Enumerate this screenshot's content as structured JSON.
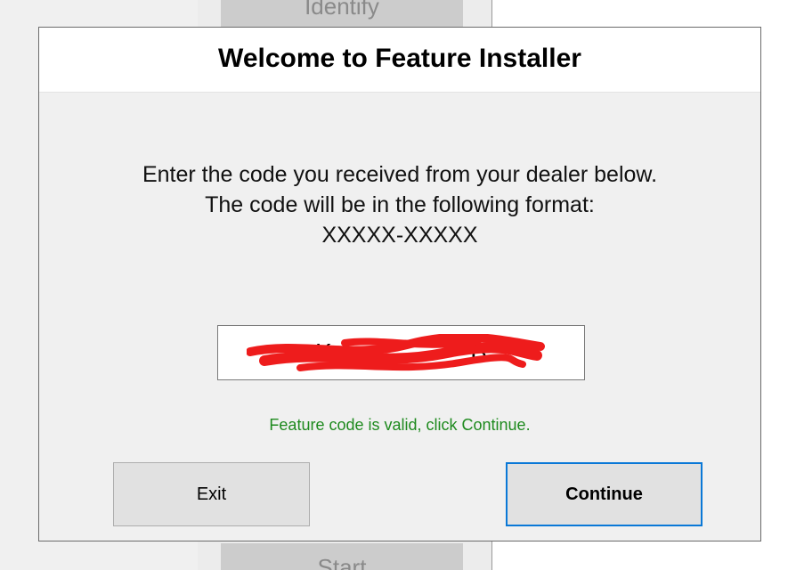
{
  "background": {
    "top_button_label": "Identify",
    "bottom_button_label": "Start"
  },
  "dialog": {
    "title": "Welcome to Feature Installer",
    "instructions": [
      "Enter the code you received from your dealer below.",
      "The code will be in the following format:",
      "XXXXX-XXXXX"
    ],
    "code_input_value": "K                    B",
    "status_message": "Feature code is valid, click Continue.",
    "status_color": "#1e8a1e",
    "exit_label": "Exit",
    "continue_label": "Continue",
    "accent_color": "#0a78d7"
  }
}
